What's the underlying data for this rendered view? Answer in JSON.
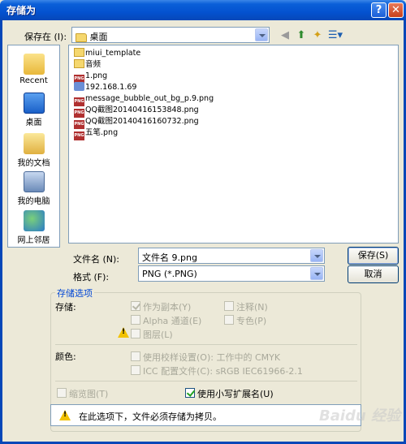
{
  "window": {
    "title": "存储为",
    "help_btn": "?",
    "close_btn": "✕"
  },
  "toolbar": {
    "save_in_label": "保存在 (I):",
    "save_in_value": "桌面",
    "back_icon": "◀",
    "up_icon": "⬆",
    "new_folder_icon": "✦",
    "views_icon": "☰▾"
  },
  "places": [
    {
      "label": "Recent",
      "icon": "recent-icon"
    },
    {
      "label": "桌面",
      "icon": "desktop-icon"
    },
    {
      "label": "我的文档",
      "icon": "my-documents-icon"
    },
    {
      "label": "我的电脑",
      "icon": "my-computer-icon"
    },
    {
      "label": "网上邻居",
      "icon": "network-icon"
    }
  ],
  "files": [
    {
      "name": "miui_template",
      "type": "folder"
    },
    {
      "name": "音频",
      "type": "folder"
    },
    {
      "name": "1.png",
      "type": "png"
    },
    {
      "name": "192.168.1.69",
      "type": "net"
    },
    {
      "name": "message_bubble_out_bg_p.9.png",
      "type": "png"
    },
    {
      "name": "QQ截图20140416153848.png",
      "type": "png"
    },
    {
      "name": "QQ截图20140416160732.png",
      "type": "png"
    },
    {
      "name": "五笔.png",
      "type": "png"
    }
  ],
  "filename": {
    "label": "文件名 (N):",
    "value": "文件名 9.png"
  },
  "format": {
    "label": "格式 (F):",
    "value": "PNG (*.PNG)"
  },
  "buttons": {
    "save": "保存(S)",
    "cancel": "取消"
  },
  "options": {
    "title": "存储选项",
    "storage_label": "存储:",
    "as_copy": "作为副本(Y)",
    "annotations": "注释(N)",
    "alpha": "Alpha 通道(E)",
    "spot": "专色(P)",
    "layers": "图层(L)",
    "color_label": "颜色:",
    "proof": "使用校样设置(O):  工作中的 CMYK",
    "icc": "ICC 配置文件(C):  sRGB IEC61966-2.1",
    "thumbnail": "缩览图(T)",
    "lowercase": "使用小写扩展名(U)",
    "note": "在此选项下，文件必须存储为拷贝。"
  },
  "watermark": "Baidu 经验"
}
